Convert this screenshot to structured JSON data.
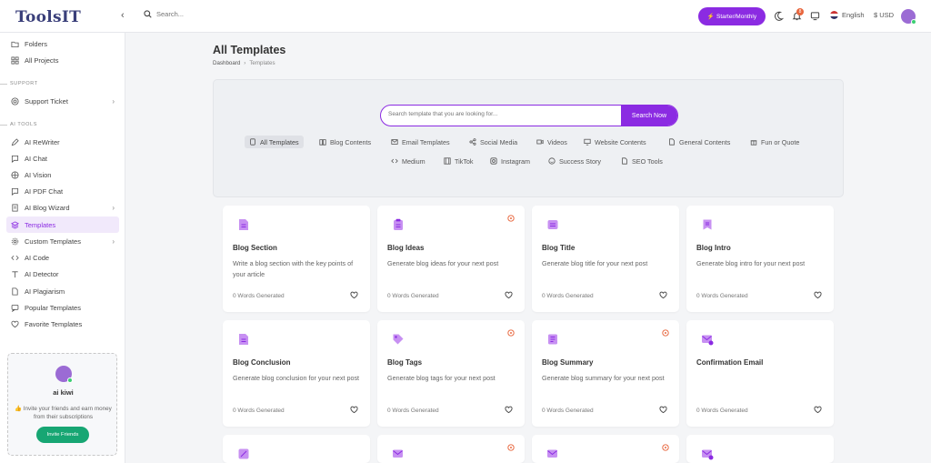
{
  "header": {
    "logo": "ToolsIT",
    "search_placeholder": "Search...",
    "plan_label": "Starter/Monthly",
    "notification_count": "8",
    "language": "English",
    "currency": "$ USD"
  },
  "sidebar": {
    "items_top": [
      {
        "label": "Folders",
        "icon": "folder-icon"
      },
      {
        "label": "All Projects",
        "icon": "grid-icon"
      }
    ],
    "support_label": "SUPPORT",
    "support_items": [
      {
        "label": "Support Ticket",
        "icon": "lifebuoy-icon"
      }
    ],
    "ai_tools_label": "AI TOOLS",
    "ai_items": [
      {
        "label": "AI ReWriter",
        "icon": "pen-icon"
      },
      {
        "label": "AI Chat",
        "icon": "chat-icon"
      },
      {
        "label": "AI Vision",
        "icon": "aperture-icon"
      },
      {
        "label": "AI PDF Chat",
        "icon": "pdf-chat-icon"
      },
      {
        "label": "AI Blog Wizard",
        "icon": "blog-icon"
      },
      {
        "label": "Templates",
        "icon": "layers-icon"
      },
      {
        "label": "Custom Templates",
        "icon": "gear-icon"
      },
      {
        "label": "AI Code",
        "icon": "code-icon"
      },
      {
        "label": "AI Detector",
        "icon": "text-icon"
      },
      {
        "label": "AI Plagiarism",
        "icon": "document-icon"
      },
      {
        "label": "Popular Templates",
        "icon": "message-icon"
      },
      {
        "label": "Favorite Templates",
        "icon": "heart-icon"
      }
    ],
    "invite": {
      "name": "ai kiwi",
      "text": "👍 Invite your friends and earn money from their subscriptions",
      "button": "Invite Friends"
    }
  },
  "main": {
    "title": "All Templates",
    "breadcrumb": [
      "Dashboard",
      "Templates"
    ],
    "search_placeholder": "Search template that you are looking for...",
    "search_button": "Search Now",
    "categories": [
      "All Templates",
      "Blog Contents",
      "Email Templates",
      "Social Media",
      "Videos",
      "Website Contents",
      "General Contents",
      "Fun or Quote",
      "Medium",
      "TikTok",
      "Instagram",
      "Success Story",
      "SEO Tools"
    ],
    "cards": [
      {
        "title": "Blog Section",
        "desc": "Write a blog section with the key points of your article",
        "words": "0 Words Generated"
      },
      {
        "title": "Blog Ideas",
        "desc": "Generate blog ideas for your next post",
        "words": "0 Words Generated"
      },
      {
        "title": "Blog Title",
        "desc": "Generate blog title for your next post",
        "words": "0 Words Generated"
      },
      {
        "title": "Blog Intro",
        "desc": "Generate blog intro for your next post",
        "words": "0 Words Generated"
      },
      {
        "title": "Blog Conclusion",
        "desc": "Generate blog conclusion for your next post",
        "words": "0 Words Generated"
      },
      {
        "title": "Blog Tags",
        "desc": "Generate blog tags for your next post",
        "words": "0 Words Generated"
      },
      {
        "title": "Blog Summary",
        "desc": "Generate blog summary for your next post",
        "words": "0 Words Generated"
      },
      {
        "title": "Confirmation Email",
        "desc": "",
        "words": "0 Words Generated"
      }
    ]
  },
  "colors": {
    "accent": "#8b2be2",
    "success": "#17a673",
    "badge": "#e8663d",
    "card_icon_bg": "#c790f2"
  }
}
